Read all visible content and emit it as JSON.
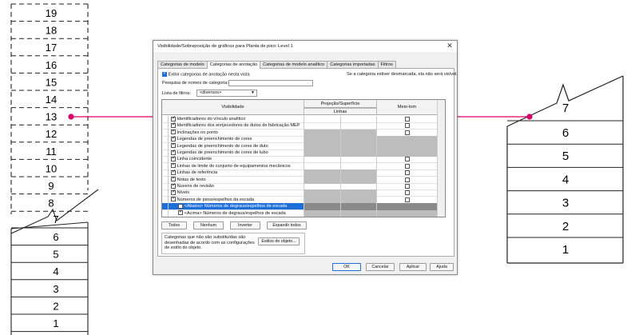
{
  "colors": {
    "callout": "#d6006b",
    "selection": "#1e6fd9",
    "gray_cell": "#bdbdbd"
  },
  "left_stair": {
    "upper_numbers": [
      "19",
      "18",
      "17",
      "16",
      "15",
      "14",
      "13",
      "12",
      "11",
      "10",
      "9",
      "8"
    ],
    "break_number": "7",
    "lower_numbers": [
      "6",
      "5",
      "4",
      "3",
      "2",
      "1"
    ]
  },
  "right_stair": {
    "break_number": "7",
    "numbers": [
      "6",
      "5",
      "4",
      "3",
      "2",
      "1"
    ]
  },
  "dialog": {
    "title": "Visibilidade/Sobreposição de gráficos para Planta de piso: Level 1",
    "tabs": [
      "Categorias de modelo",
      "Categorias de anotação",
      "Categorias de modelo analítico",
      "Categorias importadas",
      "Filtros"
    ],
    "show_annotation_label": "Exibir categorias de anotação nesta vista",
    "hint": "Se a categoria estiver desmarcada, ela não será visível.",
    "search_label": "Pesquisa de nomes de categoria:",
    "search_value": "",
    "filter_list_label": "Lista de filtros:",
    "filter_list_value": "<diversos>",
    "headers": {
      "visibility": "Visibilidade",
      "projection_surface": "Projeção/Superfície",
      "lines": "Linhas",
      "halftone": "Meio-tom"
    },
    "rows": [
      {
        "name": "Identificadores do vínculo analítico",
        "checked": true,
        "gray": false,
        "halftone_box": true
      },
      {
        "name": "Identificadores dos enrijecedores de dutos de fabricação MEP",
        "checked": true,
        "gray": false,
        "halftone_box": true
      },
      {
        "name": "Inclinações no ponto",
        "checked": true,
        "gray": true,
        "halftone_box": true
      },
      {
        "name": "Legendas de preenchimento de cores",
        "checked": true,
        "gray": true,
        "halftone_box": false
      },
      {
        "name": "Legendas de preenchimento de cores de duto",
        "checked": true,
        "gray": true,
        "halftone_box": false
      },
      {
        "name": "Legendas de preenchimento de cores de tubo",
        "checked": true,
        "gray": true,
        "halftone_box": false
      },
      {
        "name": "Linha coincidente",
        "checked": true,
        "gray": false,
        "halftone_box": true
      },
      {
        "name": "Linhas de limite do conjunto de equipamentos mecânicos",
        "checked": true,
        "gray": false,
        "halftone_box": true
      },
      {
        "name": "Linhas de referência",
        "checked": true,
        "gray": true,
        "halftone_box": true
      },
      {
        "name": "Notas de texto",
        "checked": true,
        "gray": true,
        "halftone_box": true
      },
      {
        "name": "Nuvens de revisão",
        "checked": true,
        "gray": false,
        "halftone_box": true
      },
      {
        "name": "Níveis",
        "checked": true,
        "gray": true,
        "halftone_box": true
      },
      {
        "name": "Números de pisos/espelhos da escada",
        "checked": true,
        "gray": true,
        "halftone_box": true
      },
      {
        "name": "<Abaixo> Números de degraus/espelhos de escada",
        "checked": false,
        "gray": false,
        "halftone_box": false
      },
      {
        "name": "<Acima> Números de degraus/espelhos de escada",
        "checked": true,
        "gray": true,
        "halftone_box": false
      }
    ],
    "buttons": {
      "all": "Todos",
      "none": "Nenhum",
      "invert": "Inverter",
      "expand_all": "Expandir todos"
    },
    "note": "Categorias que não são substituídas são desenhadas de acordo com as configurações de estilo do objeto.",
    "object_styles_button": "Estilos de objeto...",
    "footer": {
      "ok": "OK",
      "cancel": "Cancelar",
      "apply": "Aplicar",
      "help": "Ajuda"
    }
  }
}
